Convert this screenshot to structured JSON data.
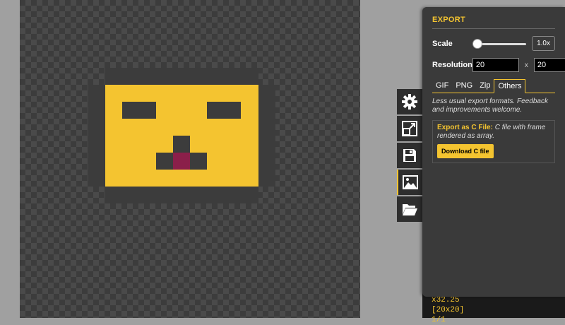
{
  "export_panel": {
    "title": "EXPORT",
    "scale": {
      "label": "Scale",
      "value": "1.0x",
      "slider_fraction": 0.0
    },
    "resolution": {
      "label": "Resolution",
      "width": "20",
      "separator": "x",
      "height": "20"
    },
    "tabs": [
      {
        "label": "GIF",
        "active": false
      },
      {
        "label": "PNG",
        "active": false
      },
      {
        "label": "Zip",
        "active": false
      },
      {
        "label": "Others",
        "active": true
      }
    ],
    "description": "Less usual export formats. Feedback and improvements welcome.",
    "c_file": {
      "name": "Export as C File:",
      "description": "C file with frame rendered as array.",
      "button": "Download C file"
    }
  },
  "side_tools": [
    {
      "name": "settings-gear-icon"
    },
    {
      "name": "resize-icon"
    },
    {
      "name": "save-floppy-icon"
    },
    {
      "name": "export-image-icon",
      "active": true
    },
    {
      "name": "open-folder-icon"
    }
  ],
  "info": {
    "zoom": "x32.25",
    "size": "[20x20]",
    "extra": "1/1"
  },
  "colors": {
    "accent": "#f4c430",
    "sprite_body": "#f4c430",
    "sprite_outline": "#3c3c3c",
    "sprite_tongue": "#8b1f4a"
  }
}
